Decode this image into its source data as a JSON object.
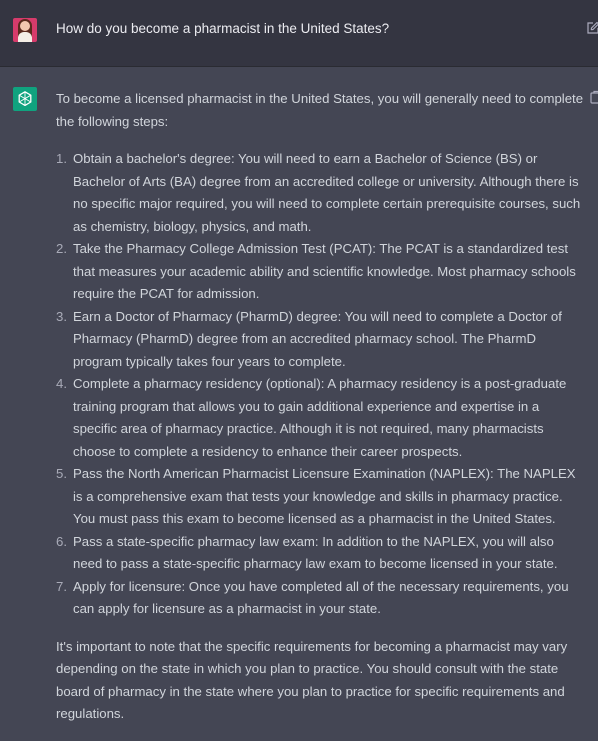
{
  "user_message": {
    "text": "How do you become a pharmacist in the United States?",
    "avatar": "user-avatar-icon",
    "action_icon": "edit-icon"
  },
  "assistant_message": {
    "avatar": "chatgpt-logo-icon",
    "action_icon": "copy-icon",
    "intro": "To become a licensed pharmacist in the United States, you will generally need to complete the following steps:",
    "steps": [
      {
        "num": "1.",
        "text": "Obtain a bachelor's degree: You will need to earn a Bachelor of Science (BS) or Bachelor of Arts (BA) degree from an accredited college or university. Although there is no specific major required, you will need to complete certain prerequisite courses, such as chemistry, biology, physics, and math."
      },
      {
        "num": "2.",
        "text": "Take the Pharmacy College Admission Test (PCAT): The PCAT is a standardized test that measures your academic ability and scientific knowledge. Most pharmacy schools require the PCAT for admission."
      },
      {
        "num": "3.",
        "text": "Earn a Doctor of Pharmacy (PharmD) degree: You will need to complete a Doctor of Pharmacy (PharmD) degree from an accredited pharmacy school. The PharmD program typically takes four years to complete."
      },
      {
        "num": "4.",
        "text": "Complete a pharmacy residency (optional): A pharmacy residency is a post-graduate training program that allows you to gain additional experience and expertise in a specific area of pharmacy practice. Although it is not required, many pharmacists choose to complete a residency to enhance their career prospects."
      },
      {
        "num": "5.",
        "text": "Pass the North American Pharmacist Licensure Examination (NAPLEX): The NAPLEX is a comprehensive exam that tests your knowledge and skills in pharmacy practice. You must pass this exam to become licensed as a pharmacist in the United States."
      },
      {
        "num": "6.",
        "text": "Pass a state-specific pharmacy law exam: In addition to the NAPLEX, you will also need to pass a state-specific pharmacy law exam to become licensed in your state."
      },
      {
        "num": "7.",
        "text": "Apply for licensure: Once you have completed all of the necessary requirements, you can apply for licensure as a pharmacist in your state."
      }
    ],
    "closing": "It's important to note that the specific requirements for becoming a pharmacist may vary depending on the state in which you plan to practice. You should consult with the state board of pharmacy in the state where you plan to practice for specific requirements and regulations."
  },
  "colors": {
    "user_bg": "#343541",
    "assistant_bg": "#444654",
    "chatgpt_green": "#10a37f",
    "text": "#d1d5db"
  }
}
